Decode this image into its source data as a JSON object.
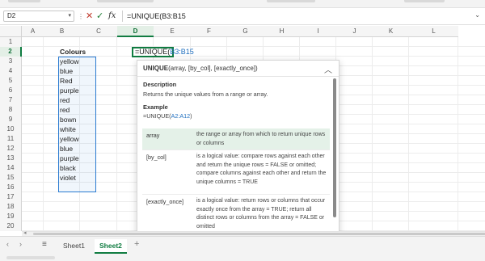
{
  "formula_bar": {
    "name_box": "D2",
    "cancel_icon": "✕",
    "enter_icon": "✓",
    "fx_label": "fx",
    "formula": "=UNIQUE(B3:B15"
  },
  "columns": [
    "A",
    "B",
    "C",
    "D",
    "E",
    "F",
    "G",
    "H",
    "I",
    "J",
    "K",
    "L"
  ],
  "rows": [
    "1",
    "2",
    "3",
    "4",
    "5",
    "6",
    "7",
    "8",
    "9",
    "10",
    "11",
    "12",
    "13",
    "14",
    "15",
    "16",
    "17",
    "18",
    "19",
    "20"
  ],
  "selected_column": "D",
  "selected_row": "2",
  "cells": {
    "b2": "Colours",
    "colours": [
      "yellow",
      "blue",
      "Red",
      "purple",
      "red",
      "red",
      "bown",
      "white",
      "yellow",
      "blue",
      "purple",
      "black",
      "violet"
    ],
    "d2_prefix": "=UNIQUE(",
    "d2_ref": "B3:B15"
  },
  "tooltip": {
    "signature_fn": "UNIQUE",
    "signature_args": "(array, [by_col], [exactly_once])",
    "description_label": "Description",
    "description_text": "Returns the unique values from a range or array.",
    "example_label": "Example",
    "example_prefix": "=UNIQUE(",
    "example_ref": "A2:A12",
    "example_suffix": ")",
    "collapse_icon": "chevron-up-icon",
    "args": [
      {
        "name": "array",
        "desc": "the range or array from which to return unique rows or columns"
      },
      {
        "name": "[by_col]",
        "desc": "is a logical value: compare rows against each other and return the unique rows = FALSE or omitted; compare columns against each other and return the unique columns = TRUE"
      },
      {
        "name": "[exactly_once]",
        "desc": "is a logical value: return rows or columns that occur exactly once from the array = TRUE; return all distinct rows or columns from the array = FALSE or omitted"
      }
    ]
  },
  "sheet_tabs": {
    "tabs": [
      "Sheet1",
      "Sheet2"
    ],
    "active": "Sheet2",
    "add_icon": "+"
  },
  "colors": {
    "accent_green": "#107c41",
    "range_blue": "#2b7bd1",
    "highlight_row": "#e4f1e8"
  }
}
